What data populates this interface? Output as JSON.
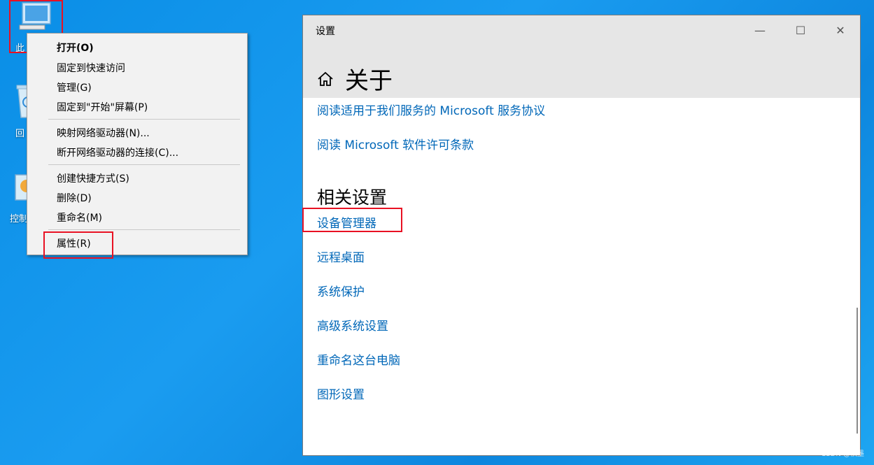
{
  "desktop": {
    "icons": [
      {
        "label": "此",
        "icon": "computer-icon"
      },
      {
        "label": "回",
        "icon": "recycle-bin-icon"
      },
      {
        "label": "控制",
        "icon": "control-panel-icon"
      }
    ]
  },
  "context_menu": {
    "items": [
      {
        "label": "打开(O)"
      },
      {
        "label": "固定到快速访问"
      },
      {
        "label": "管理(G)"
      },
      {
        "label": "固定到\"开始\"屏幕(P)"
      },
      {
        "label": "映射网络驱动器(N)..."
      },
      {
        "label": "断开网络驱动器的连接(C)..."
      },
      {
        "label": "创建快捷方式(S)"
      },
      {
        "label": "删除(D)"
      },
      {
        "label": "重命名(M)"
      },
      {
        "label": "属性(R)"
      }
    ]
  },
  "settings": {
    "window_title": "设置",
    "page_title": "关于",
    "links": [
      "阅读适用于我们服务的 Microsoft 服务协议",
      "阅读 Microsoft 软件许可条款"
    ],
    "related_title": "相关设置",
    "related_links": [
      "设备管理器",
      "远程桌面",
      "系统保护",
      "高级系统设置",
      "重命名这台电脑",
      "图形设置"
    ],
    "controls": {
      "minimize": "—",
      "maximize": "☐",
      "close": "✕"
    }
  },
  "watermark": "CSDN @棋墨",
  "colors": {
    "link": "#0067b8",
    "highlight": "#e81123",
    "desktop": "#0a8ee6"
  }
}
